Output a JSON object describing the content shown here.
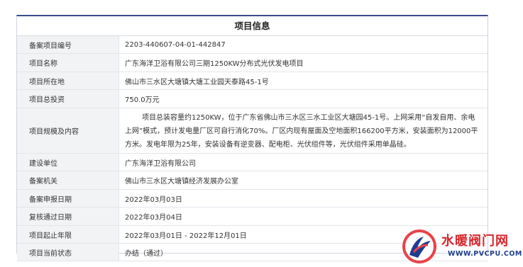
{
  "title": "项目信息",
  "rows": [
    {
      "key": "备案项目编号",
      "value": "2203-440607-04-01-442847"
    },
    {
      "key": "项目名称",
      "value": "广东海洋卫浴有限公司三期1250KW分布式光伏发电项目"
    },
    {
      "key": "项目所在地",
      "value": "佛山市三水区大塘镇大塘工业园天泰路45-1号"
    },
    {
      "key": "项目总投资",
      "value": "750.0万元"
    },
    {
      "key": "项目规模及内容",
      "value": "项目总装容量约1250KW，位于广东省佛山市三水区三水工业区大塘园45-1号。上网采用“自发自用、余电上网”模式，预计发电量厂区可自行消化70%。厂区内现有屋面及空地面积166200平方米，安装面积为12000平方米。发电年限为25年，安装设备有逆变器、配电柜、光伏组件等，光伏组件采用单晶硅。"
    },
    {
      "key": "建设单位",
      "value": "广东海洋卫浴有限公司"
    },
    {
      "key": "备案机关",
      "value": "佛山市三水区大塘镇经济发展办公室"
    },
    {
      "key": "备案申报日期",
      "value": "2022年03月03日"
    },
    {
      "key": "复核通过日期",
      "value": "2022年03月04日"
    },
    {
      "key": "项目起止年限",
      "value": "2022年03月01日 - 2022年12月01日"
    },
    {
      "key": "项目当前状态",
      "value": "办结（通过）"
    }
  ],
  "watermark": {
    "name": "水暖阀门网",
    "url": "WWW.PVCPU.COM"
  },
  "colors": {
    "header_border": "#3b4a8a",
    "label_bg": "#f2f3f5",
    "watermark_red": "#d9262c",
    "watermark_blue": "#1d3d8f"
  }
}
